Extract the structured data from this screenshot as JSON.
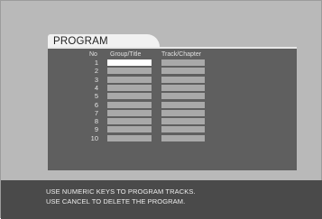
{
  "screen": {
    "title": "PROGRAM"
  },
  "table": {
    "headers": {
      "no": "No",
      "group_title": "Group/Title",
      "track_chapter": "Track/Chapter"
    },
    "rows": [
      {
        "no": "1",
        "group_title": "",
        "track_chapter": "",
        "selected": true
      },
      {
        "no": "2",
        "group_title": "",
        "track_chapter": "",
        "selected": false
      },
      {
        "no": "3",
        "group_title": "",
        "track_chapter": "",
        "selected": false
      },
      {
        "no": "4",
        "group_title": "",
        "track_chapter": "",
        "selected": false
      },
      {
        "no": "5",
        "group_title": "",
        "track_chapter": "",
        "selected": false
      },
      {
        "no": "6",
        "group_title": "",
        "track_chapter": "",
        "selected": false
      },
      {
        "no": "7",
        "group_title": "",
        "track_chapter": "",
        "selected": false
      },
      {
        "no": "8",
        "group_title": "",
        "track_chapter": "",
        "selected": false
      },
      {
        "no": "9",
        "group_title": "",
        "track_chapter": "",
        "selected": false
      },
      {
        "no": "10",
        "group_title": "",
        "track_chapter": "",
        "selected": false
      }
    ]
  },
  "footer": {
    "line1": "USE NUMERIC KEYS TO PROGRAM TRACKS.",
    "line2": "USE CANCEL TO DELETE THE PROGRAM."
  },
  "colors": {
    "background": "#b9b9b9",
    "panel": "#5f5f5f",
    "footer": "#4a4a4a",
    "cell": "#a9a9a9",
    "selected_cell": "#ffffff"
  }
}
